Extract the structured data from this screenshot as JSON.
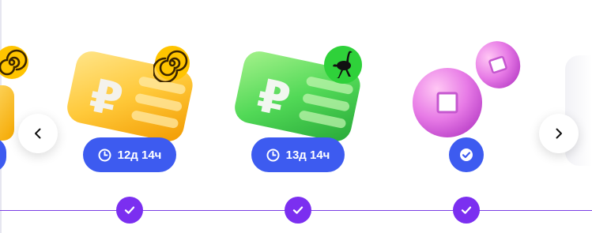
{
  "rewards": [
    {
      "badge_text": "12д 14ч",
      "badge_icon": "clock-icon",
      "corner_icon": "spiral-icon",
      "item_icon": "ruble-ticket-icon",
      "ticket_color": "#ffc93a"
    },
    {
      "badge_text": "13д 14ч",
      "badge_icon": "clock-icon",
      "corner_icon": "ostrich-icon",
      "item_icon": "ruble-ticket-icon",
      "ticket_color": "#52d957"
    },
    {
      "badge_text": "",
      "badge_icon": "check-circle-icon",
      "item_icon": "coins-icon",
      "coin_color": "#e77ae6"
    }
  ],
  "navigation": {
    "prev": "chevron-left-icon",
    "next": "chevron-right-icon"
  },
  "colors": {
    "badge": "#3d5bf0",
    "timeline": "#7b3fe4",
    "check_node": "#7b2ff0"
  }
}
